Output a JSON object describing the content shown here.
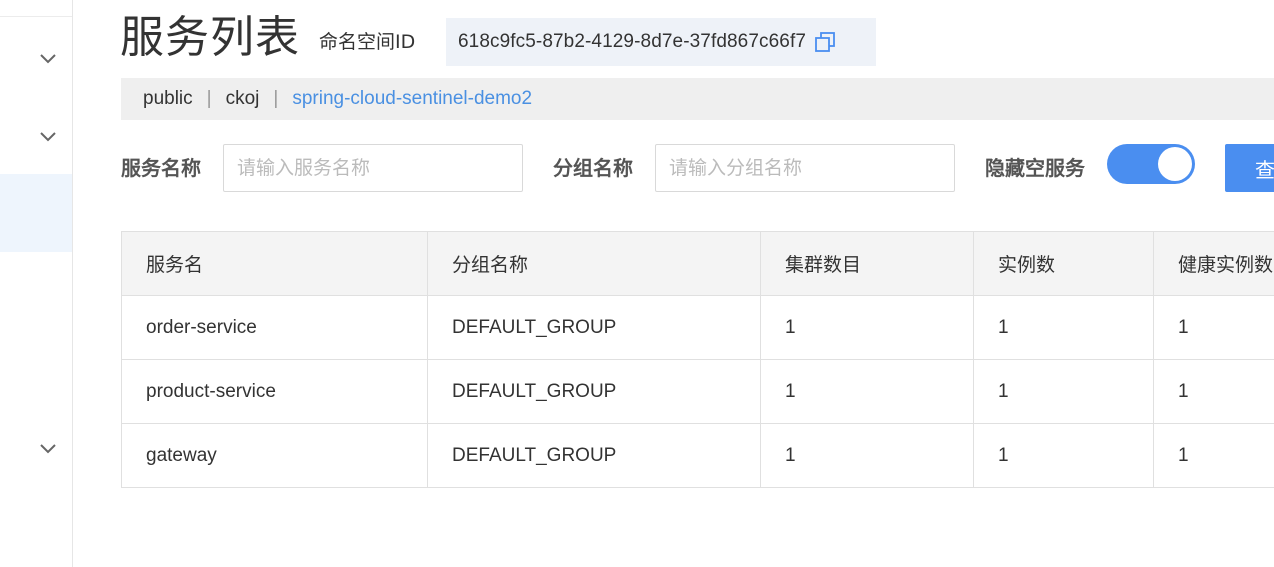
{
  "header": {
    "title": "服务列表",
    "namespace_label": "命名空间ID",
    "namespace_id": "618c9fc5-87b2-4129-8d7e-37fd867c66f7"
  },
  "breadcrumb": {
    "items": [
      "public",
      "ckoj",
      "spring-cloud-sentinel-demo2"
    ],
    "separator": "|",
    "active_index": 2
  },
  "filters": {
    "service_name_label": "服务名称",
    "service_name_placeholder": "请输入服务名称",
    "group_name_label": "分组名称",
    "group_name_placeholder": "请输入分组名称",
    "hide_empty_label": "隐藏空服务",
    "hide_empty_on": true,
    "query_button": "查询"
  },
  "table": {
    "columns": [
      "服务名",
      "分组名称",
      "集群数目",
      "实例数",
      "健康实例数"
    ],
    "rows": [
      [
        "order-service",
        "DEFAULT_GROUP",
        "1",
        "1",
        "1"
      ],
      [
        "product-service",
        "DEFAULT_GROUP",
        "1",
        "1",
        "1"
      ],
      [
        "gateway",
        "DEFAULT_GROUP",
        "1",
        "1",
        "1"
      ]
    ]
  },
  "icons": {
    "sidebar_expand": "chevron-down-icon",
    "copy": "copy-icon"
  },
  "colors": {
    "accent": "#4a8ef0",
    "link": "#4a90e2",
    "breadcrumb_bg": "#efefef",
    "namespace_bg": "#eef2f8"
  }
}
